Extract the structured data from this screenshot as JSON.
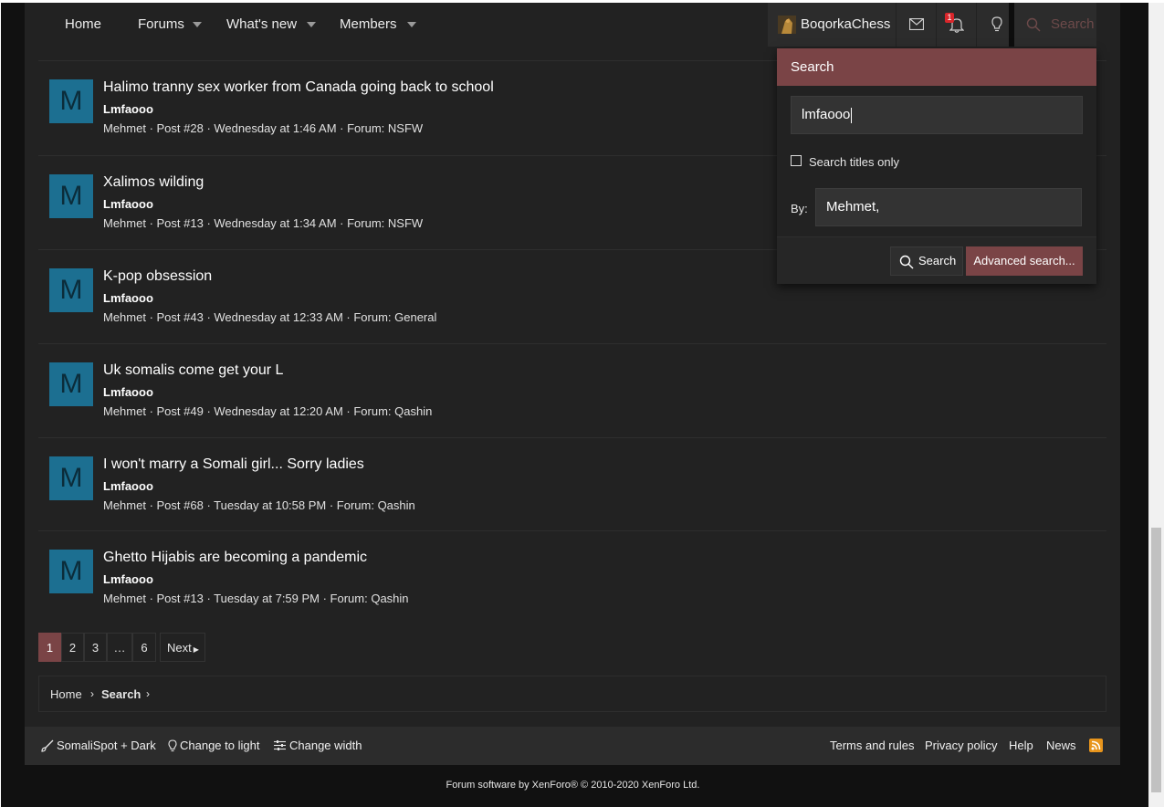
{
  "nav": {
    "items": [
      {
        "label": "Home",
        "has_caret": false
      },
      {
        "label": "Forums",
        "has_caret": true
      },
      {
        "label": "What's new",
        "has_caret": true
      },
      {
        "label": "Members",
        "has_caret": true
      }
    ],
    "username": "BoqorkaChess",
    "alert_count": "1",
    "search_label": "Search"
  },
  "results": [
    {
      "title": "Halimo tranny sex worker from Canada going back to school",
      "snippet": "Lmfaooo",
      "meta": "Mehmet · Post #28 · Wednesday at 1:46 AM · Forum: NSFW",
      "avatar_letter": "M"
    },
    {
      "title": "Xalimos wilding",
      "snippet": "Lmfaooo",
      "meta": "Mehmet · Post #13 · Wednesday at 1:34 AM · Forum: NSFW",
      "avatar_letter": "M"
    },
    {
      "title": "K-pop obsession",
      "snippet": "Lmfaooo",
      "meta": "Mehmet · Post #43 · Wednesday at 12:33 AM · Forum: General",
      "avatar_letter": "M"
    },
    {
      "title": "Uk somalis come get your L",
      "snippet": "Lmfaooo",
      "meta": "Mehmet · Post #49 · Wednesday at 12:20 AM · Forum: Qashin",
      "avatar_letter": "M"
    },
    {
      "title": "I won't marry a Somali girl... Sorry ladies",
      "snippet": "Lmfaooo",
      "meta": "Mehmet · Post #68 · Tuesday at 10:58 PM · Forum: Qashin",
      "avatar_letter": "M"
    },
    {
      "title": "Ghetto Hijabis are becoming a pandemic",
      "snippet": "Lmfaooo",
      "meta": "Mehmet · Post #13 · Tuesday at 7:59 PM · Forum: Qashin",
      "avatar_letter": "M"
    }
  ],
  "pagination": {
    "pages": [
      "1",
      "2",
      "3",
      "…",
      "6"
    ],
    "current": "1",
    "next_label": "Next"
  },
  "breadcrumb": {
    "home": "Home",
    "current": "Search"
  },
  "footer": {
    "style_label": "SomaliSpot + Dark",
    "change_light": "Change to light",
    "change_width": "Change width",
    "terms": "Terms and rules",
    "privacy": "Privacy policy",
    "help": "Help",
    "news": "News",
    "copyright": "Forum software by XenForo® © 2010-2020 XenForo Ltd."
  },
  "search_popup": {
    "title": "Search",
    "query": "lmfaooo",
    "titles_only_label": "Search titles only",
    "titles_only_checked": false,
    "by_label": "By:",
    "by_value": "Mehmet,",
    "search_button": "Search",
    "advanced_button": "Advanced search..."
  },
  "colors": {
    "accent": "#7a4446",
    "avatar_bg": "#1c6f91",
    "page_bg": "#222222",
    "panel_bg": "#2c2c2c"
  }
}
